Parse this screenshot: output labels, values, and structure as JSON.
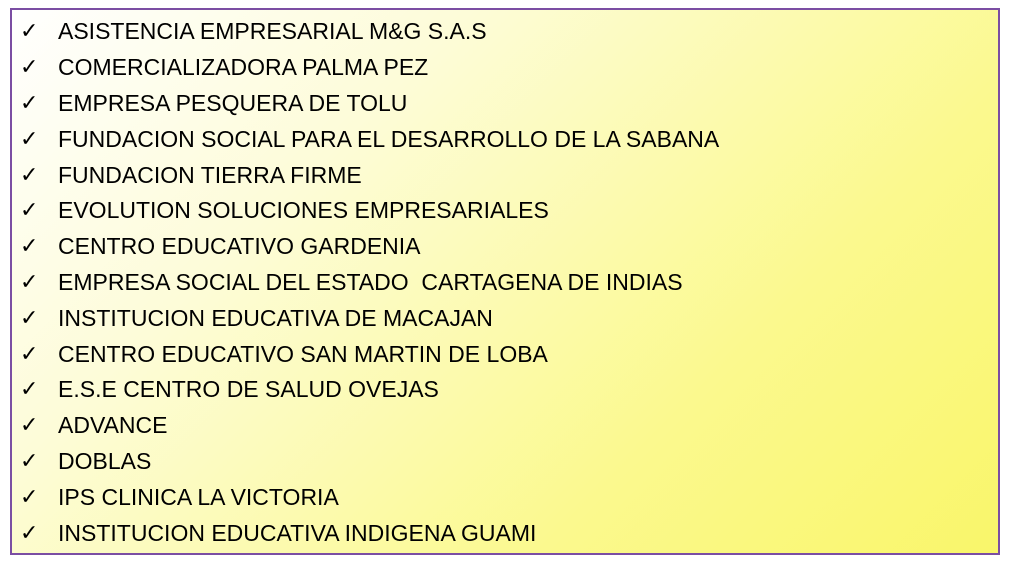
{
  "list": {
    "bullet_icon": "check-mark-icon",
    "items": [
      "ASISTENCIA EMPRESARIAL M&G S.A.S",
      "COMERCIALIZADORA PALMA PEZ",
      "EMPRESA PESQUERA DE TOLU",
      "FUNDACION SOCIAL PARA EL DESARROLLO DE LA SABANA",
      "FUNDACION TIERRA FIRME",
      "EVOLUTION SOLUCIONES EMPRESARIALES",
      "CENTRO EDUCATIVO GARDENIA",
      "EMPRESA SOCIAL DEL ESTADO  CARTAGENA DE INDIAS",
      "INSTITUCION EDUCATIVA DE MACAJAN",
      "CENTRO EDUCATIVO SAN MARTIN DE LOBA",
      "E.S.E CENTRO DE SALUD OVEJAS",
      "ADVANCE",
      "DOBLAS",
      "IPS CLINICA LA VICTORIA",
      "INSTITUCION EDUCATIVA INDIGENA GUAMI"
    ]
  },
  "colors": {
    "border": "#7b4ea3",
    "gradient_start": "#ffffff",
    "gradient_end": "#f9f66a"
  }
}
